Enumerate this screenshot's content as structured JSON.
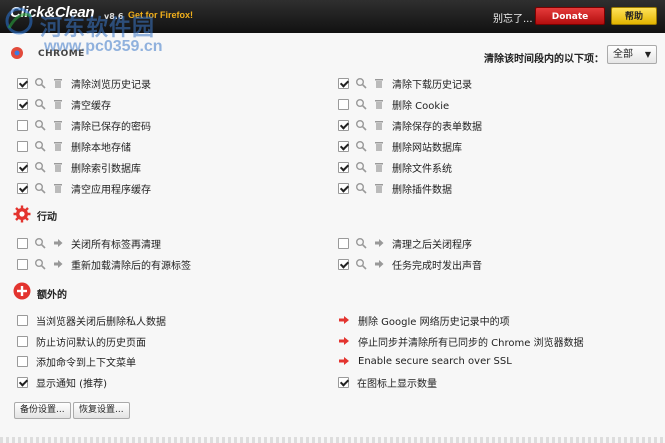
{
  "header": {
    "brand": "Click&Clean",
    "brand_version": "v8.6",
    "firefox_link": "Get for Firefox!",
    "forgot": "别忘了...",
    "donate_label": "Donate",
    "help_label": "帮助"
  },
  "watermark": {
    "text": "河东软件园",
    "url": "www.pc0359.cn"
  },
  "chrome_section": {
    "title": "CHROME",
    "range_label": "清除该时间段内的以下项：",
    "range_value": "全部"
  },
  "chrome_left": [
    {
      "label": "清除浏览历史记录",
      "checked": true
    },
    {
      "label": "清空缓存",
      "checked": true
    },
    {
      "label": "清除已保存的密码",
      "checked": false
    },
    {
      "label": "删除本地存储",
      "checked": false
    },
    {
      "label": "删除索引数据库",
      "checked": true
    },
    {
      "label": "清空应用程序缓存",
      "checked": true
    }
  ],
  "chrome_right": [
    {
      "label": "清除下载历史记录",
      "checked": true
    },
    {
      "label": "删除 Cookie",
      "checked": false
    },
    {
      "label": "清除保存的表单数据",
      "checked": true
    },
    {
      "label": "删除网站数据库",
      "checked": true
    },
    {
      "label": "删除文件系统",
      "checked": true
    },
    {
      "label": "删除插件数据",
      "checked": true
    }
  ],
  "actions_section": {
    "title": "行动",
    "left": [
      {
        "label": "关闭所有标签再清理",
        "checked": false
      },
      {
        "label": "重新加载清除后的有源标签",
        "checked": false
      }
    ],
    "right": [
      {
        "label": "清理之后关闭程序",
        "checked": false
      },
      {
        "label": "任务完成时发出声音",
        "checked": true
      }
    ]
  },
  "extra_section": {
    "title": "额外的",
    "left": [
      {
        "label": "当浏览器关闭后删除私人数据",
        "checked": false
      },
      {
        "label": "防止访问默认的历史页面",
        "checked": false
      },
      {
        "label": "添加命令到上下文菜单",
        "checked": false
      },
      {
        "label": "显示通知 (推荐)",
        "checked": true
      }
    ],
    "right": [
      {
        "label": "删除 Google 网络历史记录中的项",
        "type": "arrow"
      },
      {
        "label": "停止同步并清除所有已同步的 Chrome 浏览器数据",
        "type": "arrow"
      },
      {
        "label": "Enable secure search over SSL",
        "type": "arrow"
      },
      {
        "label": "在图标上显示数量",
        "type": "checkbox",
        "checked": true
      }
    ]
  },
  "footer": {
    "backup_label": "备份设置...",
    "restore_label": "恢复设置..."
  },
  "colors": {
    "accent_red": "#e3342f",
    "donate": "#c71414",
    "help": "#f2c400"
  }
}
